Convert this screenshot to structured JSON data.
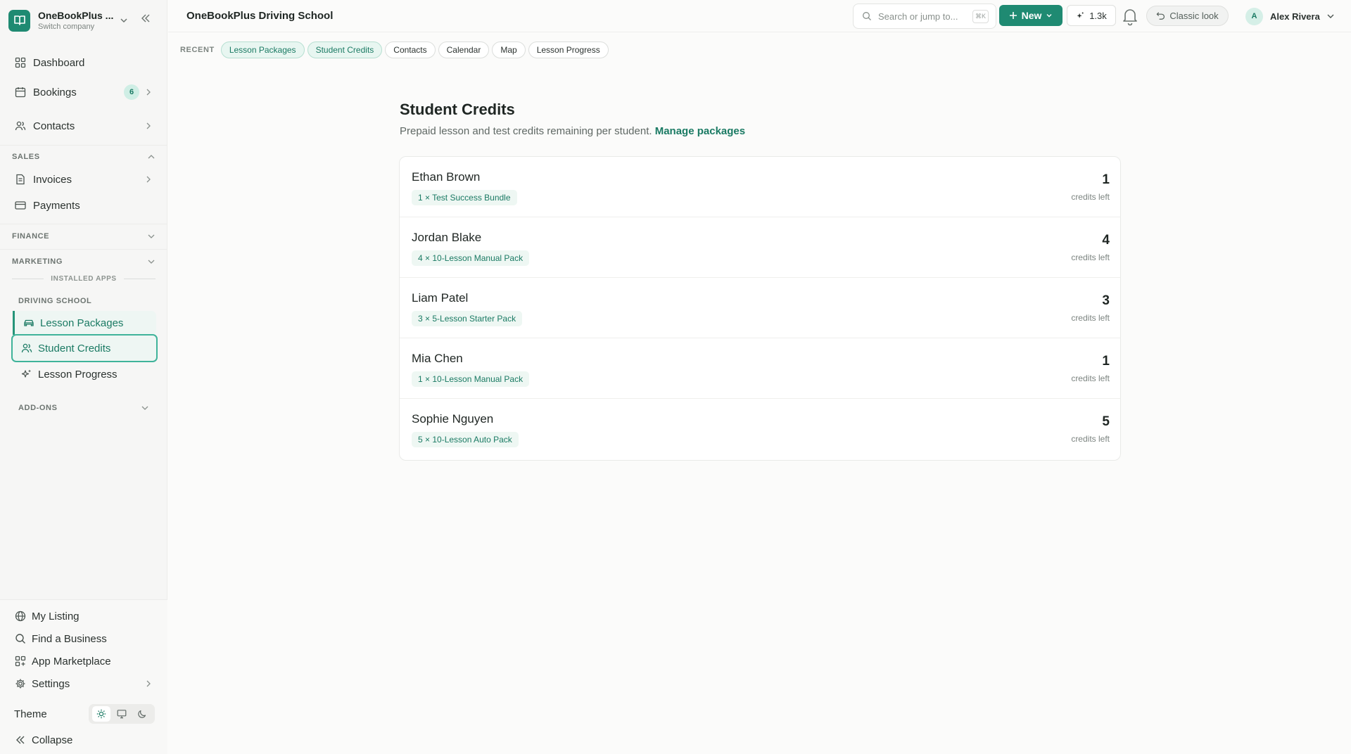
{
  "brand": {
    "name": "OneBookPlus ...",
    "sub": "Switch company"
  },
  "nav": {
    "dashboard": "Dashboard",
    "bookings": "Bookings",
    "bookings_badge": "6",
    "contacts": "Contacts"
  },
  "sections": {
    "sales": "SALES",
    "finance": "FINANCE",
    "marketing": "MARKETING",
    "installed_apps": "INSTALLED APPS",
    "driving_school": "DRIVING SCHOOL",
    "add_ons": "ADD-ONS"
  },
  "sales_items": {
    "invoices": "Invoices",
    "payments": "Payments"
  },
  "driving_items": {
    "lesson_packages": "Lesson Packages",
    "student_credits": "Student Credits",
    "lesson_progress": "Lesson Progress"
  },
  "bottom": {
    "my_listing": "My Listing",
    "find_business": "Find a Business",
    "marketplace": "App Marketplace",
    "settings": "Settings",
    "theme": "Theme",
    "collapse": "Collapse"
  },
  "topbar": {
    "title": "OneBookPlus Driving School",
    "search_placeholder": "Search or jump to...",
    "search_kbd": "⌘K",
    "new_label": "New",
    "credits_count": "1.3k",
    "classic_label": "Classic look",
    "user_initial": "A",
    "user_name": "Alex Rivera"
  },
  "recent": {
    "label": "RECENT",
    "chips": [
      "Lesson Packages",
      "Student Credits",
      "Contacts",
      "Calendar",
      "Map",
      "Lesson Progress"
    ]
  },
  "main": {
    "title": "Student Credits",
    "description": "Prepaid lesson and test credits remaining per student.",
    "manage_link": "Manage packages",
    "credits_suffix": "credits left",
    "students": [
      {
        "name": "Ethan Brown",
        "package": "1 × Test Success Bundle",
        "credits": "1"
      },
      {
        "name": "Jordan Blake",
        "package": "4 × 10-Lesson Manual Pack",
        "credits": "4"
      },
      {
        "name": "Liam Patel",
        "package": "3 × 5-Lesson Starter Pack",
        "credits": "3"
      },
      {
        "name": "Mia Chen",
        "package": "1 × 10-Lesson Manual Pack",
        "credits": "1"
      },
      {
        "name": "Sophie Nguyen",
        "package": "5 × 10-Lesson Auto Pack",
        "credits": "5"
      }
    ]
  },
  "colors": {
    "accent": "#1f8a72",
    "accent_light": "#e8f6f1",
    "text": "#1f2623"
  }
}
